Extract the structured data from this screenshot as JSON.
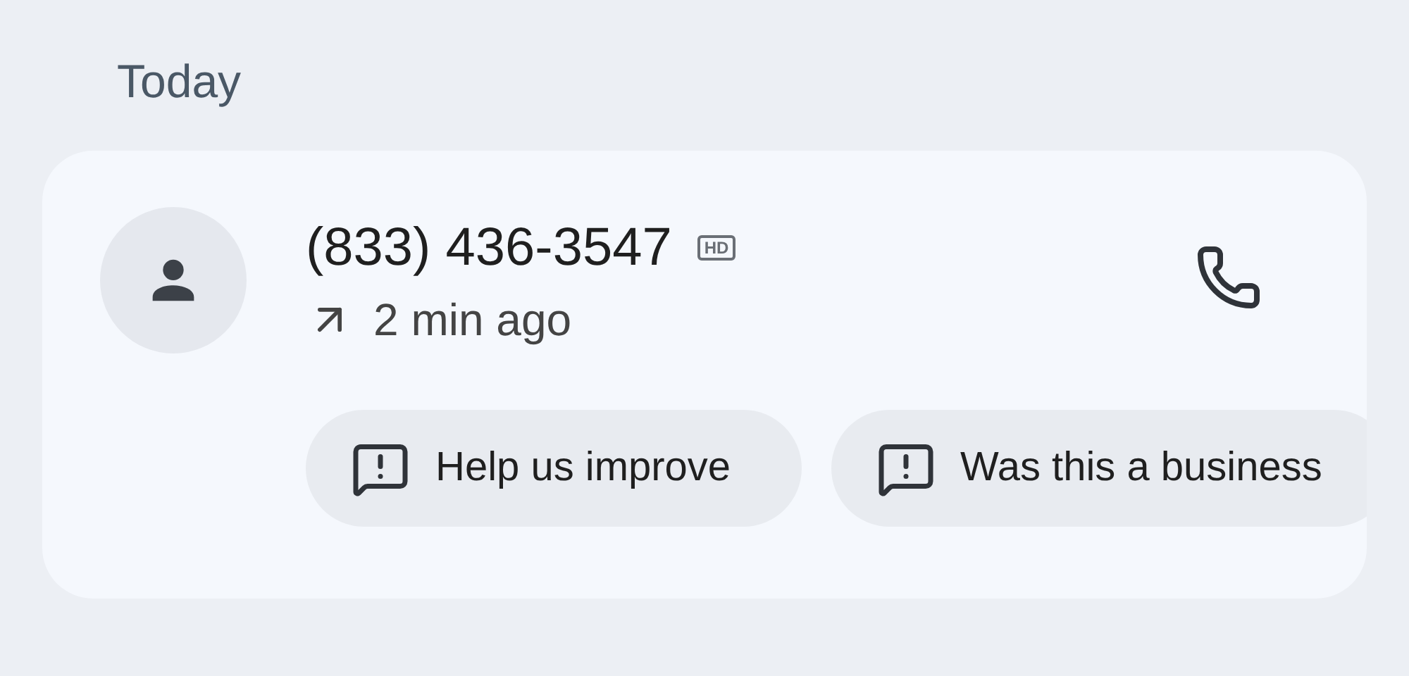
{
  "section_title": "Today",
  "call": {
    "number": "(833) 436-3547",
    "hd_badge": "HD",
    "kind": "outgoing",
    "time": "2 min ago",
    "chips": [
      {
        "label": "Help us improve"
      },
      {
        "label": "Was this a business"
      }
    ]
  }
}
